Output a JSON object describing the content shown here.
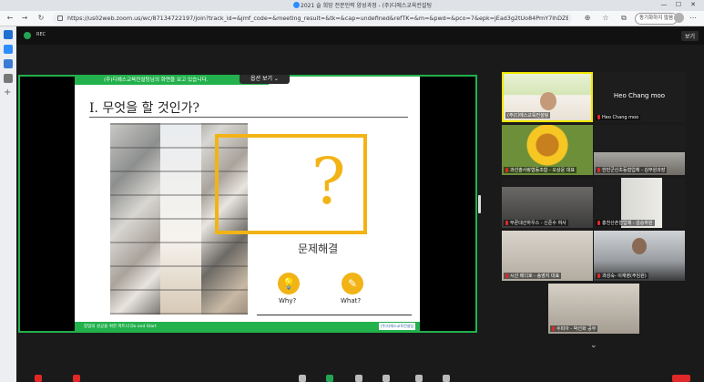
{
  "tab": {
    "title": "2021 슬 희망 전문인력 양성과정 - (주)디에스교육컨설팅"
  },
  "window": {
    "minimize": "—",
    "maximize": "☐",
    "close": "✕"
  },
  "address": {
    "url": "https://us02web.zoom.us/wc/87134722197/join?track_id=&jmf_code=&meeting_result=&tk=&cap=undefined&refTK=&m=&pwd=&pco=7&epk=jEad3g2tUo84PmY7lhDZEEd1FxH7l9_zK9O6TGQbwF..."
  },
  "sync_button": "동기화하지 않음",
  "zoom": {
    "view_label": "보기",
    "rec_label": "REC"
  },
  "share": {
    "banner": "(주)디에스교육컨설팅님의 화면을 보고 있습니다.",
    "view_options": "옵션 보기 ⌄"
  },
  "slide": {
    "title": "I. 무엇을 할 것인가?",
    "problem_label": "문제해결",
    "why_label": "Why?",
    "what_label": "What?",
    "footer_text": "창업의 성공을 위한 파트너 Do and Start",
    "footer_logo": "(주)디에스교육컨설팅"
  },
  "participants": [
    {
      "name": "(주)디에스교육컨설팅",
      "active": true
    },
    {
      "name": "Heo Chang moo",
      "display": "Heo Chang moo"
    },
    {
      "name": "과선솔사랑협동조합 - 오상윤 대표"
    },
    {
      "name": "한빈군산초등협업체 - 김부원과장"
    },
    {
      "name": "부론대선하우스 - 신준수 여사"
    },
    {
      "name": "홍천산촌협업체 - 김승하원"
    },
    {
      "name": "시산 메디호 - 송영지 대표"
    },
    {
      "name": "과성숙- 이재영(주임원)"
    },
    {
      "name": "수피아 - 박선화 공무"
    }
  ],
  "colors": {
    "accent_green": "#22b14c",
    "yellow": "#f2b316"
  }
}
